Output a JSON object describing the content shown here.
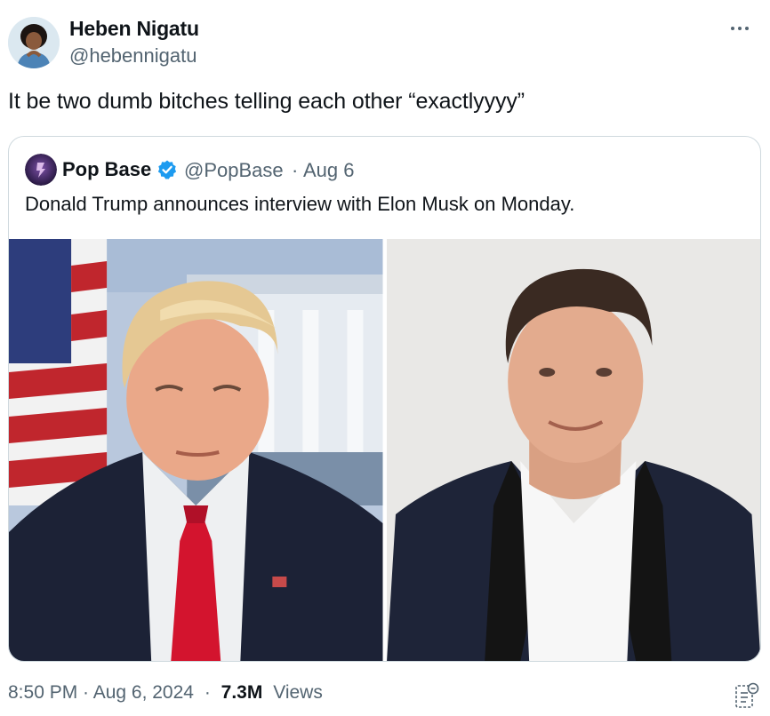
{
  "tweet": {
    "author": {
      "name": "Heben Nigatu",
      "handle": "@hebennigatu"
    },
    "text": "It be two dumb bitches telling each other “exactlyyyy”",
    "timestamp": "8:50 PM · Aug 6, 2024",
    "separator": "·",
    "views_count": "7.3M",
    "views_label": "Views"
  },
  "quote": {
    "author": {
      "name": "Pop Base",
      "handle": "@PopBase",
      "verified": true
    },
    "separator": "·",
    "date": "Aug 6",
    "text": "Donald Trump announces interview with Elon Musk on Monday.",
    "media": [
      {
        "icon": "photo-trump"
      },
      {
        "icon": "photo-musk"
      }
    ]
  },
  "colors": {
    "primary_text": "#0f1419",
    "secondary_text": "#536471",
    "border": "#cfd9de",
    "verified_blue": "#1d9bf0"
  }
}
